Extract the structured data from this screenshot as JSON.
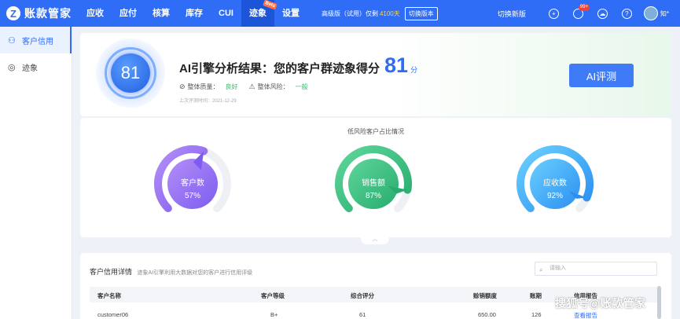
{
  "app": {
    "logo_letter": "Z",
    "name": "账款管家"
  },
  "nav": [
    {
      "label": "应收"
    },
    {
      "label": "应付"
    },
    {
      "label": "核算"
    },
    {
      "label": "库存"
    },
    {
      "label": "CUI"
    },
    {
      "label": "迹象",
      "badge": "Beta"
    },
    {
      "label": "设置"
    }
  ],
  "plan": {
    "text": "高级版（试用）仅剩",
    "days": "4100天",
    "switch": "切换版本"
  },
  "toolbar": {
    "new_version": "切换新版",
    "notice_badge": "99+",
    "user": "知*"
  },
  "sidebar": [
    {
      "label": "客户信用",
      "icon": "user-icon"
    },
    {
      "label": "迹象",
      "icon": "radar-icon"
    }
  ],
  "score": {
    "ring_value": "81",
    "title": "AI引擎分析结果：您的客户群迹象得分",
    "value": "81",
    "unit": "分",
    "quality_label": "整体质量：",
    "quality_value": "良好",
    "risk_label": "整体风险：",
    "risk_value": "一般",
    "last_eval": "上次评测时间：2021-12-29",
    "button": "AI评测"
  },
  "gauges": {
    "title": "低风险客户占比情况",
    "items": [
      {
        "label": "客户数",
        "value": "57%",
        "fraction": 0.57,
        "color_a": "#b48ef7",
        "color_b": "#7c5cf0"
      },
      {
        "label": "销售额",
        "value": "87%",
        "fraction": 0.87,
        "color_a": "#5ed69a",
        "color_b": "#27ab6e"
      },
      {
        "label": "应收数",
        "value": "92%",
        "fraction": 0.92,
        "color_a": "#6ad0ff",
        "color_b": "#2b8ff0"
      }
    ]
  },
  "table": {
    "title": "客户信用详情",
    "subtitle": "迹象AI引擎利用大数据对您的客户进行信用评级",
    "search_placeholder": "请输入",
    "headers": [
      "客户名称",
      "客户等级",
      "综合评分",
      "赊销额度",
      "账期",
      "信用报告"
    ],
    "rows": [
      {
        "name": "customer06",
        "level": "B+",
        "score": "61",
        "credit": "650.00",
        "period": "126",
        "report": "查看报告"
      }
    ]
  },
  "watermark": "搜狐号@账款管家"
}
